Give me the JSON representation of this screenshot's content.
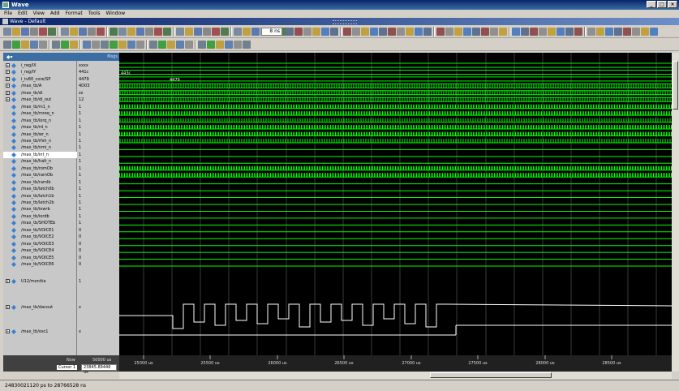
{
  "app_title": "Wave",
  "menu": [
    "File",
    "Edit",
    "View",
    "Add",
    "Format",
    "Tools",
    "Window"
  ],
  "window_title": "Wave - Default",
  "toolbar": {
    "zoom_field": "8 ns"
  },
  "panel_header": {
    "messages_label": "Msgs"
  },
  "signals": [
    {
      "name": "i_reg/IX",
      "value": "xxxx",
      "expandable": true
    },
    {
      "name": "i_reg/IY",
      "value": "441c",
      "expandable": true
    },
    {
      "name": "i_tv80_core/SP",
      "value": "4479",
      "expandable": true
    },
    {
      "name": "/max_tb/A",
      "value": "4D03",
      "expandable": true
    },
    {
      "name": "/max_tb/di",
      "value": "zz",
      "expandable": true
    },
    {
      "name": "/max_tb/di_out",
      "value": "12",
      "expandable": true
    },
    {
      "name": "/max_tb/m1_n",
      "value": "1",
      "expandable": false
    },
    {
      "name": "/max_tb/mreq_n",
      "value": "1",
      "expandable": false
    },
    {
      "name": "/max_tb/iorq_n",
      "value": "1",
      "expandable": false
    },
    {
      "name": "/max_tb/rd_n",
      "value": "1",
      "expandable": false
    },
    {
      "name": "/max_tb/wr_n",
      "value": "1",
      "expandable": false
    },
    {
      "name": "/max_tb/rfsh_n",
      "value": "1",
      "expandable": false
    },
    {
      "name": "/max_tb/nmi_n",
      "value": "1",
      "expandable": false
    },
    {
      "name": "/max_tb/int_n",
      "value": "1",
      "expandable": false,
      "selected": true
    },
    {
      "name": "/max_tb/halt_n",
      "value": "1",
      "expandable": false
    },
    {
      "name": "/max_tb/romOb",
      "value": "1",
      "expandable": false
    },
    {
      "name": "/max_tb/ramOb",
      "value": "1",
      "expandable": false
    },
    {
      "name": "/max_tb/ramIb",
      "value": "1",
      "expandable": false
    },
    {
      "name": "/max_tb/latch0b",
      "value": "1",
      "expandable": false
    },
    {
      "name": "/max_tb/latch1b",
      "value": "1",
      "expandable": false
    },
    {
      "name": "/max_tb/latch2b",
      "value": "1",
      "expandable": false
    },
    {
      "name": "/max_tb/iowrb",
      "value": "1",
      "expandable": false
    },
    {
      "name": "/max_tb/iordb",
      "value": "1",
      "expandable": false
    },
    {
      "name": "/max_tb/SHOTEb",
      "value": "1",
      "expandable": false
    },
    {
      "name": "/max_tb/VOICE1",
      "value": "0",
      "expandable": false
    },
    {
      "name": "/max_tb/VOICE2",
      "value": "0",
      "expandable": false
    },
    {
      "name": "/max_tb/VOICE3",
      "value": "0",
      "expandable": false
    },
    {
      "name": "/max_tb/VOICE4",
      "value": "0",
      "expandable": false
    },
    {
      "name": "/max_tb/VOICE5",
      "value": "0",
      "expandable": false
    },
    {
      "name": "/max_tb/VOICE6",
      "value": "0",
      "expandable": false
    },
    {
      "name": "U12/monitia",
      "value": "1",
      "expandable": true
    },
    {
      "name": "/max_tb/dacout",
      "value": "x",
      "expandable": true
    },
    {
      "name": "/max_tb/osc1",
      "value": "x",
      "expandable": true
    }
  ],
  "wave_labels": {
    "iy": "443c",
    "sp": "4479"
  },
  "bottom": {
    "now_label": "Now",
    "now_value": "50000 us",
    "cursor_label": "Cursor 1",
    "cursor_value": "23845.89446 us"
  },
  "ruler_ticks": [
    "25000 us",
    "25500 us",
    "26000 us",
    "26500 us",
    "27000 us",
    "27500 us",
    "28000 us",
    "28500 us"
  ],
  "status": "24830021120 ps to 28766528 ns",
  "colors": {
    "wave_green": "#00ff00",
    "wave_bg": "#000000",
    "grid": "#3a3a3a",
    "cursor": "#ffff00"
  }
}
